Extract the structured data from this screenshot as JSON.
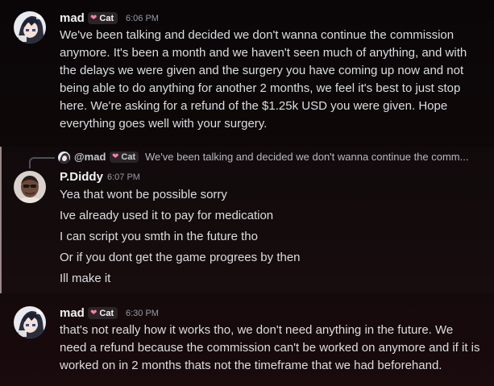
{
  "messages": [
    {
      "author": "mad",
      "badge": "Cat",
      "time": "6:06 PM",
      "text": "We've been talking and decided we don't wanna continue the commission anymore. It's been a month and we haven't seen much of anything, and with the delays we were given and the surgery you have coming up now and not being able to do anything for another 2 months, we feel it's best to just stop here. We're asking for a refund of the $1.25k USD you were given. Hope everything goes well with your surgery."
    },
    {
      "reply": {
        "author": "@mad",
        "badge": "Cat",
        "text": "We've been talking and decided we don't wanna continue the comm..."
      },
      "author": "P.Diddy",
      "time": "6:07 PM",
      "lines": [
        "Yea that wont be possible sorry",
        "Ive already used it to pay for medication",
        "I can script you smth in the future tho",
        "Or if you dont get the game progrees by then",
        "Ill make it"
      ]
    },
    {
      "author": "mad",
      "badge": "Cat",
      "time": "6:30 PM",
      "text": "that's not really how it works tho, we don't need anything in the future. We need a refund because the commission can't be worked on anymore and if it is worked on in 2 months thats not the timeframe that we had beforehand."
    }
  ],
  "colors": {
    "badge_heart": "#f47fa4",
    "username": "#f2f3f5",
    "timestamp": "#949ba4",
    "text": "#dbdee1"
  }
}
